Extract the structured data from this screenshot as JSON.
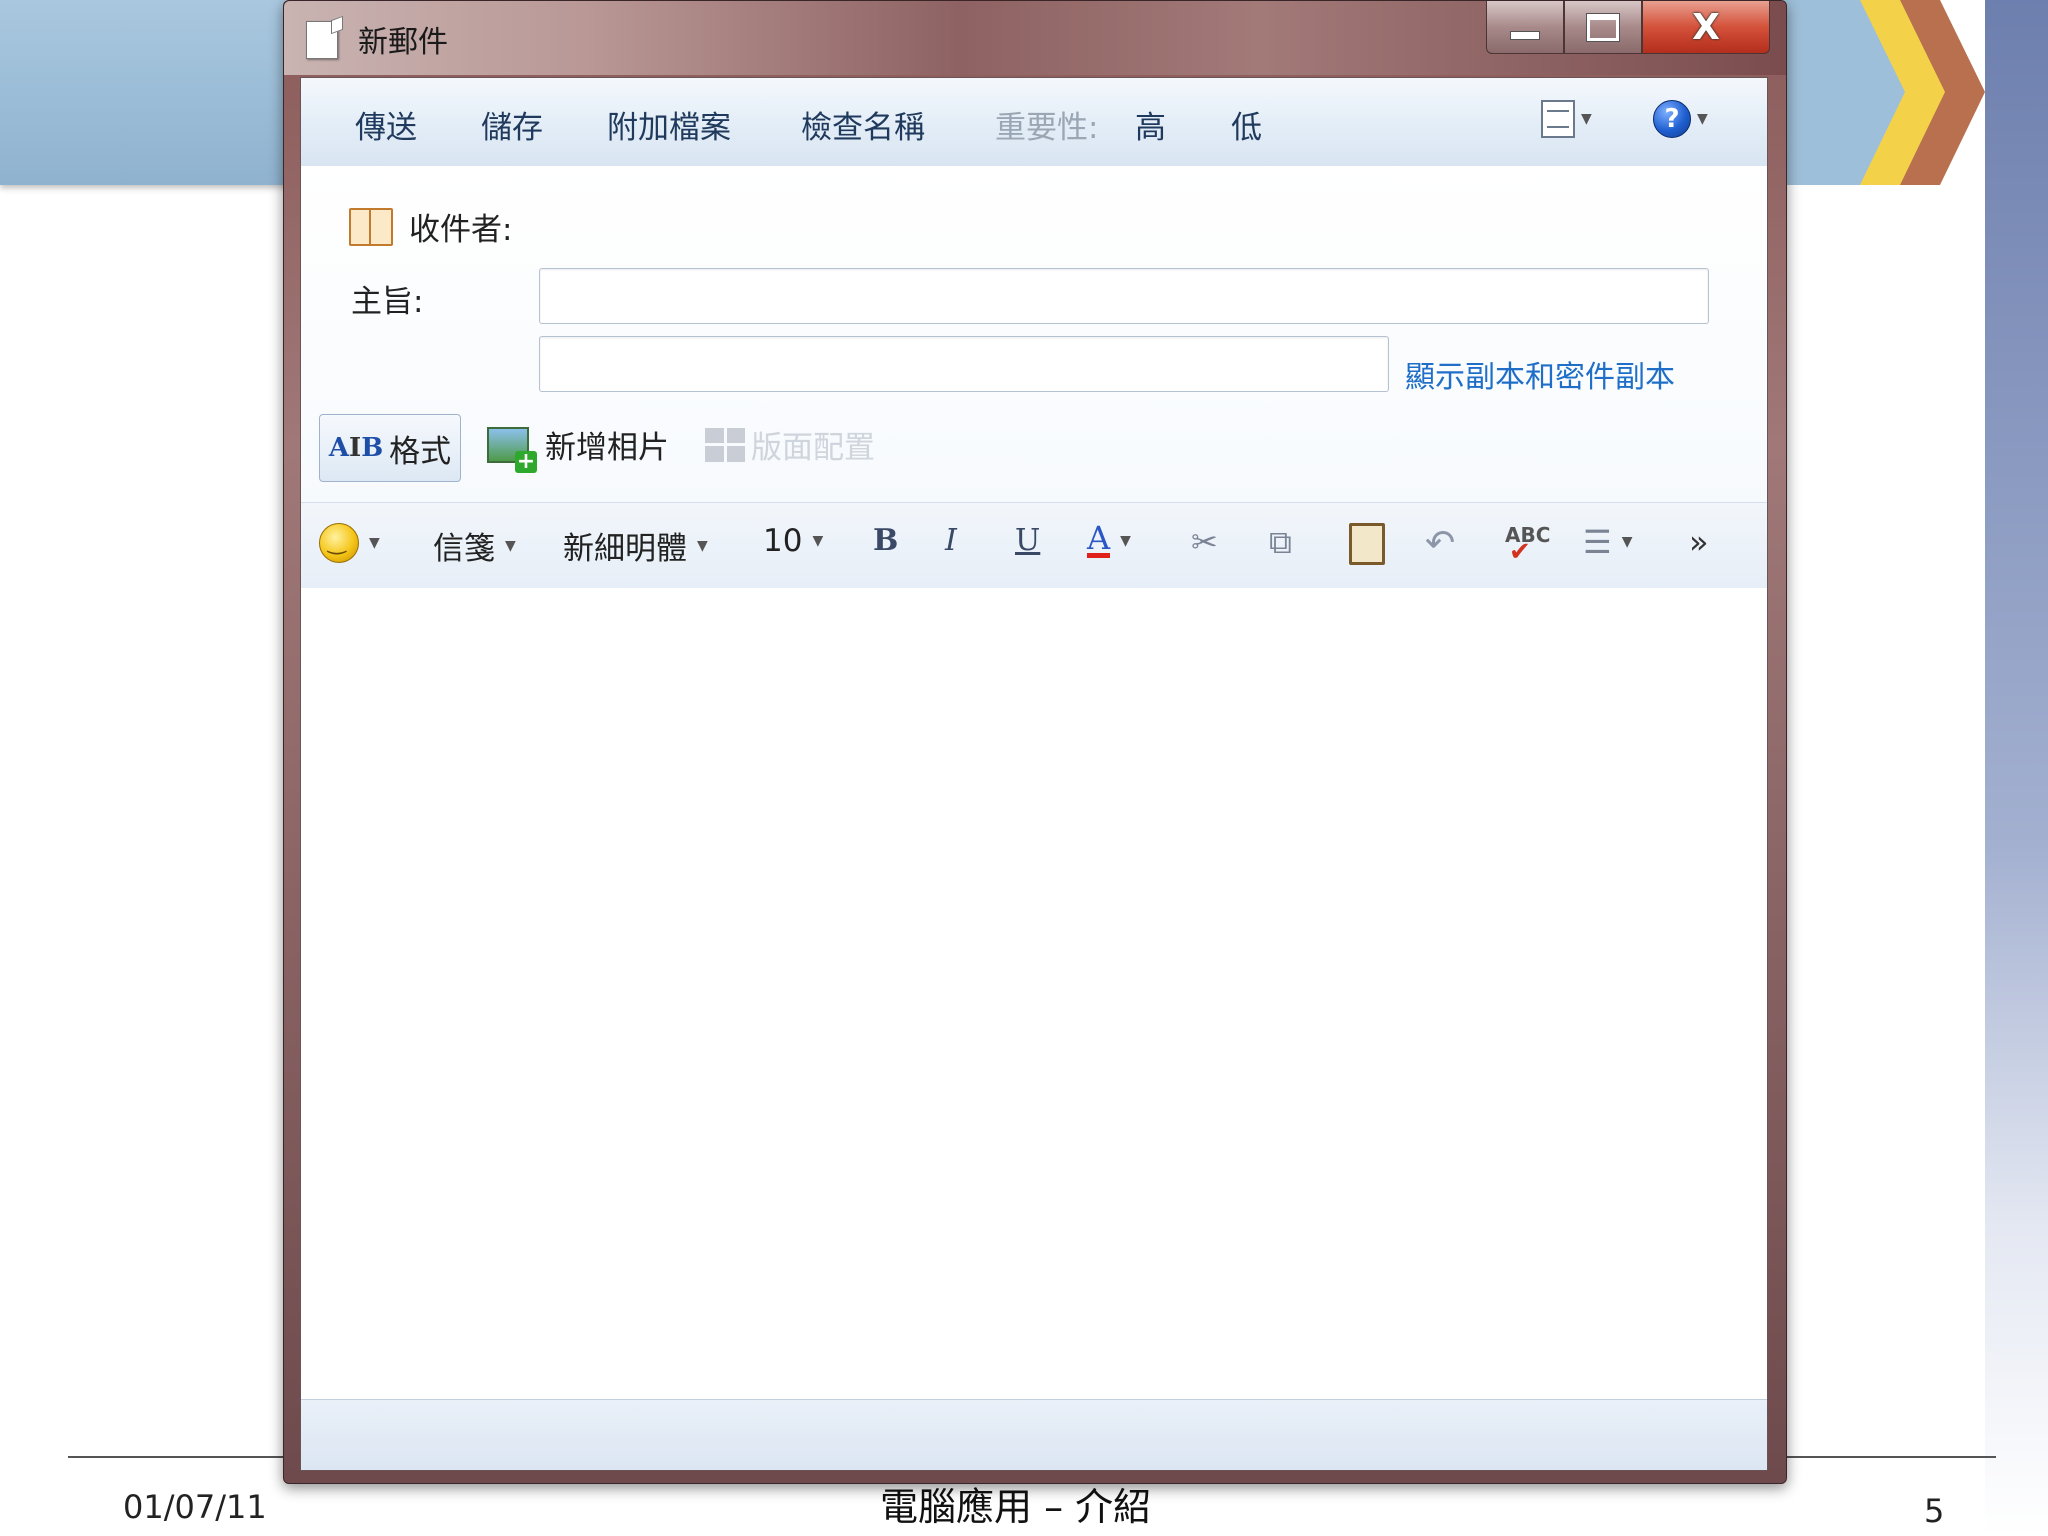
{
  "window": {
    "title": "新郵件",
    "close_glyph": "X"
  },
  "commands": {
    "send": "傳送",
    "save": "儲存",
    "attach": "附加檔案",
    "check_names": "檢查名稱",
    "importance_label": "重要性:",
    "high": "高",
    "low": "低",
    "help_glyph": "?"
  },
  "header": {
    "to_label": "收件者:",
    "to_value": "",
    "subject_label": "主旨:",
    "subject_value": "",
    "show_cc_bcc": "顯示副本和密件副本"
  },
  "toolbar": {
    "format": "格式",
    "add_photo": "新增相片",
    "layout": "版面配置"
  },
  "format_bar": {
    "stationery": "信箋",
    "font": "新細明體",
    "font_size": "10",
    "bold": "B",
    "italic": "I",
    "underline": "U",
    "font_color": "A",
    "more": "»"
  },
  "slide": {
    "date": "01/07/11",
    "footer_title": "電腦應用 – 介紹",
    "page_number": "5"
  },
  "colors": {
    "accent_link": "#1f6fc8",
    "chevron_yellow": "#f3d24a",
    "chevron_brown": "#b8704f",
    "band_blue": "#9ebfd9"
  }
}
